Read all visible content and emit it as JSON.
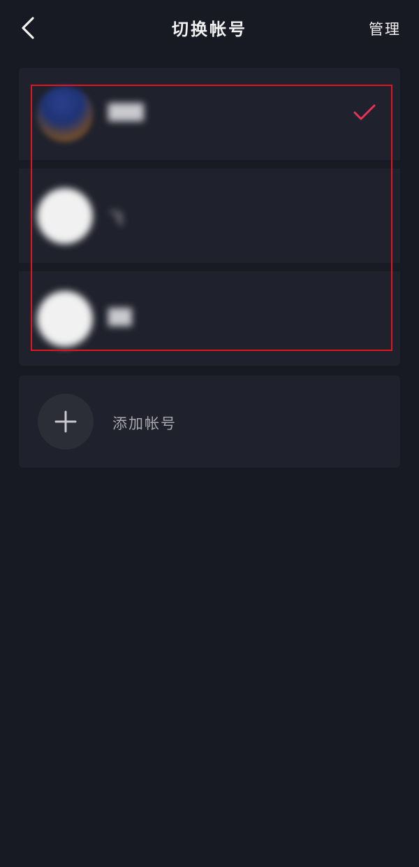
{
  "header": {
    "title": "切换帐号",
    "manage_label": "管理",
    "back_icon": "chevron-left-icon"
  },
  "accounts": [
    {
      "name": "███",
      "selected": true
    },
    {
      "name": "飞",
      "selected": false
    },
    {
      "name": "██",
      "selected": false
    }
  ],
  "add_account": {
    "label": "添加帐号",
    "icon": "plus-icon"
  },
  "colors": {
    "background": "#181a23",
    "card": "#1f212c",
    "accent": "#e8325a",
    "highlight": "#e0161e"
  }
}
